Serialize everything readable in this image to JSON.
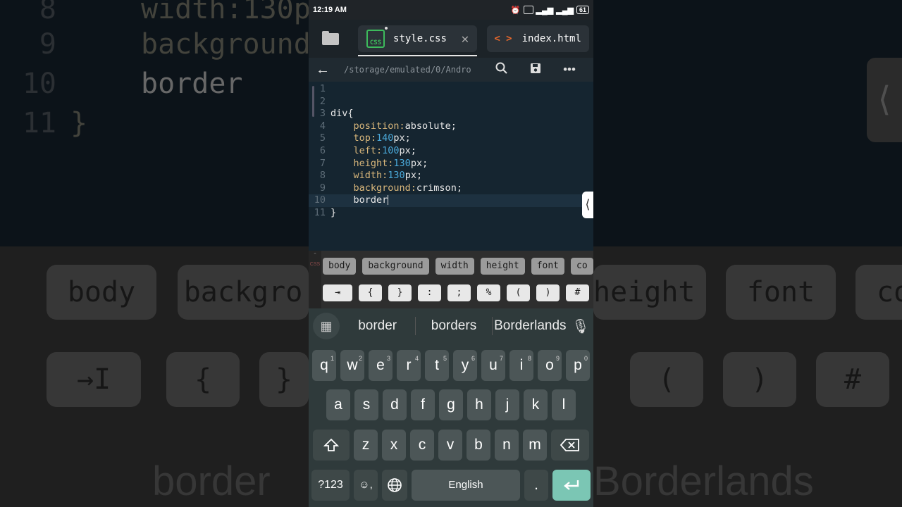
{
  "status": {
    "time": "12:19 AM",
    "battery": "61"
  },
  "tabs": [
    {
      "label": "style.css",
      "badge": "CSS",
      "close": "✕"
    },
    {
      "label": "index.html",
      "badge": "< >"
    }
  ],
  "pathbar": {
    "path": "/storage/emulated/0/Andro"
  },
  "code": [
    {
      "n": "1"
    },
    {
      "n": "2"
    },
    {
      "n": "3",
      "tokens": [
        "div{"
      ]
    },
    {
      "n": "4",
      "prop": "position:",
      "val": "absolute;"
    },
    {
      "n": "5",
      "prop": "top:",
      "num": "140",
      "unit": "px;"
    },
    {
      "n": "6",
      "prop": "left:",
      "num": "100",
      "unit": "px;"
    },
    {
      "n": "7",
      "prop": "height:",
      "num": "130",
      "unit": "px;"
    },
    {
      "n": "8",
      "prop": "width:",
      "num": "130",
      "unit": "px;"
    },
    {
      "n": "9",
      "prop": "background:",
      "val": "crimson;"
    },
    {
      "n": "10",
      "text": "border"
    },
    {
      "n": "11",
      "text": "}"
    }
  ],
  "chips": [
    "body",
    "background",
    "width",
    "height",
    "font",
    "co"
  ],
  "symbols": [
    "⇥",
    "{",
    "}",
    ":",
    ";",
    "%",
    "(",
    ")",
    "#"
  ],
  "side_label": "CSS",
  "suggestions": [
    "border",
    "borders",
    "Borderlands"
  ],
  "keyboard": {
    "row1": [
      [
        "q",
        "1"
      ],
      [
        "w",
        "2"
      ],
      [
        "e",
        "3"
      ],
      [
        "r",
        "4"
      ],
      [
        "t",
        "5"
      ],
      [
        "y",
        "6"
      ],
      [
        "u",
        "7"
      ],
      [
        "i",
        "8"
      ],
      [
        "o",
        "9"
      ],
      [
        "p",
        "0"
      ]
    ],
    "row2": [
      "a",
      "s",
      "d",
      "f",
      "g",
      "h",
      "j",
      "k",
      "l"
    ],
    "row3": [
      "z",
      "x",
      "c",
      "v",
      "b",
      "n",
      "m"
    ],
    "num_key": "?123",
    "emoji_key": "☺,",
    "space_label": "English",
    "period": "."
  },
  "background": {
    "big_lines": [
      {
        "n": "8",
        "text": "width:130p"
      },
      {
        "n": "9",
        "text": "background"
      },
      {
        "n": "10",
        "text": "border"
      },
      {
        "n": "11",
        "text": "}"
      }
    ],
    "chips_left": [
      "body",
      "backgro"
    ],
    "chips_right": [
      "height",
      "font",
      "co"
    ],
    "syms_left": [
      "→I",
      "{",
      "}"
    ],
    "syms_right": [
      "(",
      ")",
      "#"
    ],
    "sugg_left": "border",
    "sugg_right": "Borderlands"
  },
  "colors": {
    "accent": "#3dbb5c",
    "enter": "#7bc6b4",
    "editor_bg": "#152530",
    "crimson_keyword": "#d9b77b"
  }
}
